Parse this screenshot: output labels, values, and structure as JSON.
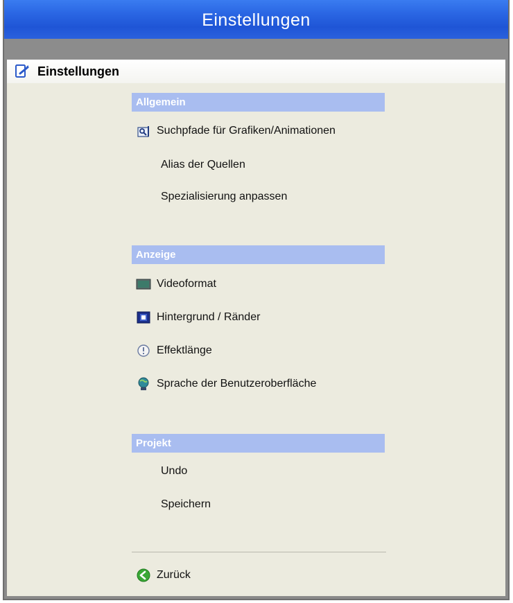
{
  "window": {
    "title": "Einstellungen"
  },
  "header": {
    "title": "Einstellungen",
    "icon": "settings-icon"
  },
  "sections": [
    {
      "title": "Allgemein",
      "items": [
        {
          "label": "Suchpfade für Grafiken/Animationen",
          "icon": "search-path-icon"
        },
        {
          "label": "Alias der Quellen"
        },
        {
          "label": "Spezialisierung anpassen"
        }
      ]
    },
    {
      "title": "Anzeige",
      "items": [
        {
          "label": "Videoformat",
          "icon": "monitor-icon"
        },
        {
          "label": "Hintergrund / Ränder",
          "icon": "background-icon"
        },
        {
          "label": "Effektlänge",
          "icon": "info-icon"
        },
        {
          "label": "Sprache der Benutzeroberfläche",
          "icon": "globe-icon"
        }
      ]
    },
    {
      "title": "Projekt",
      "items": [
        {
          "label": "Undo"
        },
        {
          "label": "Speichern"
        }
      ]
    }
  ],
  "footer": {
    "back_label": "Zurück",
    "icon": "back-arrow-icon"
  },
  "colors": {
    "titlebar": "#2a66e3",
    "section_header": "#a9bdf0",
    "panel": "#ecebdf"
  }
}
